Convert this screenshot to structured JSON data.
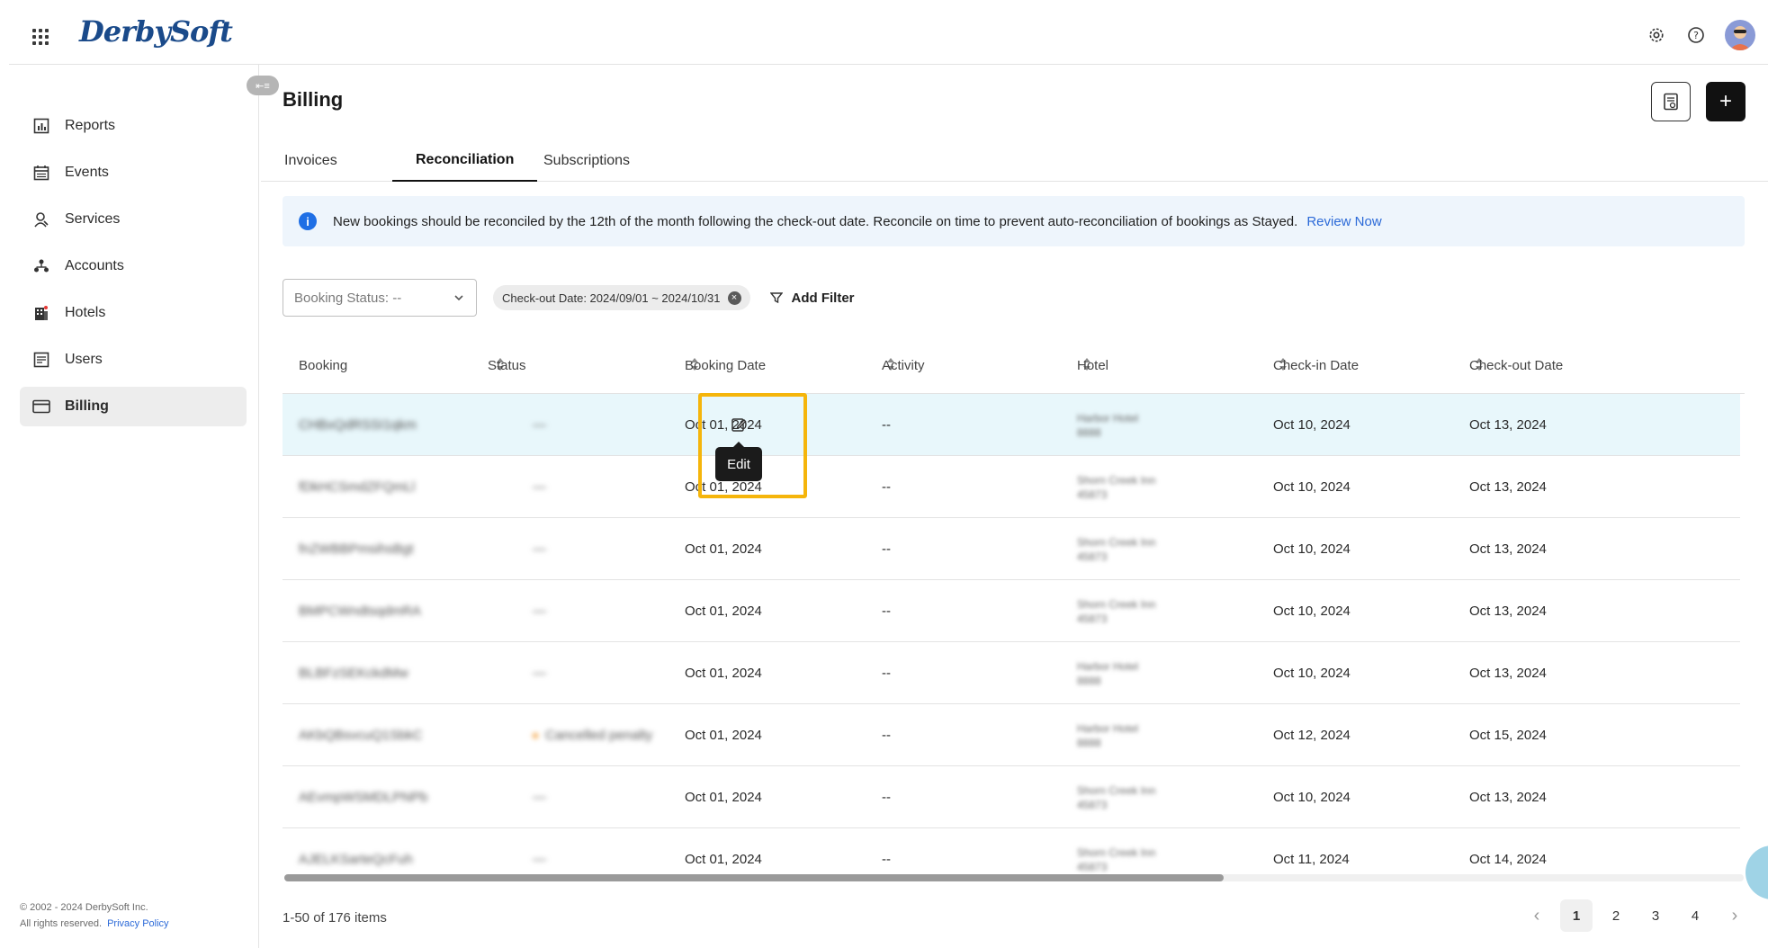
{
  "brand": {
    "logo_text": "DerbySoft"
  },
  "header": {
    "icons": [
      "apps-grid-icon",
      "settings-icon",
      "help-icon",
      "user-avatar"
    ]
  },
  "sidebar": {
    "items": [
      {
        "label": "Reports",
        "icon": "reports-icon"
      },
      {
        "label": "Events",
        "icon": "events-icon"
      },
      {
        "label": "Services",
        "icon": "services-icon"
      },
      {
        "label": "Accounts",
        "icon": "accounts-icon"
      },
      {
        "label": "Hotels",
        "icon": "hotels-icon"
      },
      {
        "label": "Users",
        "icon": "users-icon"
      },
      {
        "label": "Billing",
        "icon": "billing-icon",
        "active": true
      }
    ],
    "footer_copyright": "© 2002 - 2024 DerbySoft Inc.",
    "footer_rights": "All rights reserved.",
    "footer_privacy": "Privacy Policy"
  },
  "page": {
    "title": "Billing"
  },
  "tabs": [
    {
      "label": "Invoices"
    },
    {
      "label": "Reconciliation",
      "active": true
    },
    {
      "label": "Subscriptions"
    }
  ],
  "banner": {
    "text": "New bookings should be reconciled by the 12th of the month following the check-out date. Reconcile on time to prevent auto-reconciliation of bookings as Stayed.",
    "link": "Review Now"
  },
  "filters": {
    "booking_status": "Booking Status: --",
    "chip": "Check-out Date: 2024/09/01 ~ 2024/10/31",
    "add_filter": "Add Filter"
  },
  "table": {
    "columns": [
      "Booking",
      "Status",
      "Booking Date",
      "Activity",
      "Hotel",
      "Check-in Date",
      "Check-out Date"
    ],
    "rows": [
      {
        "booking": "CHBxQdRSSI1qkm",
        "status": "—",
        "booking_date": "Oct 01, 2024",
        "activity": "--",
        "hotel": "Harbor Hotel",
        "hotel_code": "8888",
        "checkin": "Oct 10, 2024",
        "checkout": "Oct 13, 2024"
      },
      {
        "booking": "fDkHCSmdZFQmLl",
        "status": "—",
        "booking_date": "Oct 01, 2024",
        "activity": "--",
        "hotel": "Shorn Creek Inn",
        "hotel_code": "45873",
        "checkin": "Oct 10, 2024",
        "checkout": "Oct 13, 2024"
      },
      {
        "booking": "fnZWBBPmsihsBgt",
        "status": "—",
        "booking_date": "Oct 01, 2024",
        "activity": "--",
        "hotel": "Shorn Creek Inn",
        "hotel_code": "45873",
        "checkin": "Oct 10, 2024",
        "checkout": "Oct 13, 2024"
      },
      {
        "booking": "BMPCWndtsqdmRA",
        "status": "—",
        "booking_date": "Oct 01, 2024",
        "activity": "--",
        "hotel": "Shorn Creek Inn",
        "hotel_code": "45873",
        "checkin": "Oct 10, 2024",
        "checkout": "Oct 13, 2024"
      },
      {
        "booking": "BLBFzSEKckdMw",
        "status": "—",
        "booking_date": "Oct 01, 2024",
        "activity": "--",
        "hotel": "Harbor Hotel",
        "hotel_code": "8888",
        "checkin": "Oct 10, 2024",
        "checkout": "Oct 13, 2024"
      },
      {
        "booking": "AKbQBsvcuQ1SbkC",
        "status": "Cancelled penalty",
        "booking_date": "Oct 01, 2024",
        "activity": "--",
        "hotel": "Harbor Hotel",
        "hotel_code": "8888",
        "checkin": "Oct 12, 2024",
        "checkout": "Oct 15, 2024"
      },
      {
        "booking": "AEvmpWSMDLPNPb",
        "status": "—",
        "booking_date": "Oct 01, 2024",
        "activity": "--",
        "hotel": "Shorn Creek Inn",
        "hotel_code": "45873",
        "checkin": "Oct 10, 2024",
        "checkout": "Oct 13, 2024"
      },
      {
        "booking": "AJELKSarteQcFuh",
        "status": "—",
        "booking_date": "Oct 01, 2024",
        "activity": "--",
        "hotel": "Shorn Creek Inn",
        "hotel_code": "45873",
        "checkin": "Oct 11, 2024",
        "checkout": "Oct 14, 2024"
      }
    ]
  },
  "tooltip": {
    "label": "Edit"
  },
  "pagination": {
    "summary": "1-50 of 176 items",
    "pages": [
      "1",
      "2",
      "3",
      "4"
    ],
    "current": "1"
  }
}
